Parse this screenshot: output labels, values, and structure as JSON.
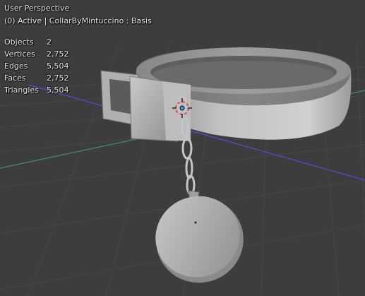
{
  "viewport": {
    "perspective_label": "User Perspective",
    "active_label": "(0) Active | CollarByMintuccino : Basis"
  },
  "stats": [
    {
      "label": "Objects",
      "value": "2"
    },
    {
      "label": "Vertices",
      "value": "2,752"
    },
    {
      "label": "Edges",
      "value": "5,504"
    },
    {
      "label": "Faces",
      "value": "2,752"
    },
    {
      "label": "Triangles",
      "value": "5,504"
    }
  ],
  "colors": {
    "background": "#3d3d3d",
    "grid": "#474747",
    "x_axis": "#7a3b49",
    "y_axis": "#5a7a2e",
    "z_axis": "#5b4bd0",
    "mesh": "#a9a9a9",
    "origin": "#e64b4b"
  },
  "icons": [
    "object-origin-icon",
    "3d-cursor-icon"
  ]
}
